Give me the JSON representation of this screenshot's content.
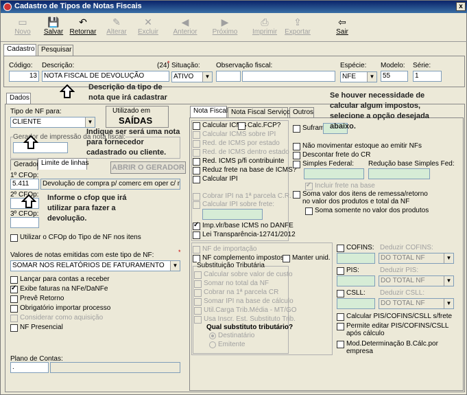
{
  "window": {
    "title": "Cadastro de Tipos de Notas Fiscais",
    "close": "x"
  },
  "toolbar": [
    {
      "label": "Novo",
      "icon": "new-icon",
      "enabled": false
    },
    {
      "label": "Salvar",
      "icon": "save-icon",
      "enabled": true
    },
    {
      "label": "Retornar",
      "icon": "undo-icon",
      "enabled": true
    },
    {
      "label": "Alterar",
      "icon": "edit-icon",
      "enabled": false
    },
    {
      "label": "Excluir",
      "icon": "delete-icon",
      "enabled": false
    },
    {
      "label": "Anterior",
      "icon": "arrow-left-icon",
      "enabled": false
    },
    {
      "label": "Próximo",
      "icon": "arrow-right-icon",
      "enabled": false
    },
    {
      "label": "Imprimir",
      "icon": "printer-icon",
      "enabled": false
    },
    {
      "label": "Exportar",
      "icon": "export-icon",
      "enabled": false
    },
    {
      "label": "Sair",
      "icon": "exit-icon",
      "enabled": true
    }
  ],
  "main_tabs": [
    "Cadastro",
    "Pesquisar"
  ],
  "header": {
    "codigo_label": "Código:",
    "codigo_value": "13",
    "descricao_label": "Descrição:",
    "descricao_counter": "(24)",
    "descricao_value": "NOTA FISCAL DE DEVOLUÇÃO",
    "situacao_label": "Situação:",
    "situacao_value": "ATIVO",
    "obs_label": "Observação fiscal:",
    "especie_label": "Espécie:",
    "especie_value": "NFE",
    "modelo_label": "Modelo:",
    "modelo_value": "55",
    "serie_label": "Série:",
    "serie_value": "1"
  },
  "left": {
    "tab_dados": "Dados",
    "tipo_nf_label": "Tipo de NF para:",
    "tipo_nf_value": "CLIENTE",
    "utilizado_em_label": "Utilizado em",
    "utilizado_em_value": "SAÍDAS",
    "gerador_group_label": "Gerador de impressão da nota fiscal:",
    "gerador_tab": "Gerador",
    "limite_tab": "Limite de linhas",
    "abrir_gerador": "ABRIR O GERADOR",
    "cfop1_label": "1º CFOp:",
    "cfop1_value": "5.411",
    "cfop1_desc": "Devolução de compra p/ comerc em oper c/ merc",
    "cfop2_label": "2º CFOp:",
    "cfop3_label": "3º CFOp:",
    "utilizar_cfop": "Utilizar o CFOp do Tipo de NF nos itens",
    "valores_label": "Valores de notas emitidas com este tipo de NF:",
    "valores_value": "SOMAR NOS RELATÓRIOS DE FATURAMENTO",
    "checks": [
      {
        "label": "Lançar para contas a receber",
        "checked": false,
        "enabled": true
      },
      {
        "label": "Exibe faturas na NFe/DaNFe",
        "checked": true,
        "enabled": true
      },
      {
        "label": "Prevê Retorno",
        "checked": false,
        "enabled": true
      },
      {
        "label": "Obrigatório importar processo",
        "checked": false,
        "enabled": true
      },
      {
        "label": "Considerar como aquisição",
        "checked": false,
        "enabled": false
      },
      {
        "label": "NF Presencial",
        "checked": false,
        "enabled": true
      }
    ],
    "plano_label": "Plano de Contas:",
    "plano_value": "."
  },
  "right_tabs": [
    "Nota Fiscal",
    "Nota Fiscal Serviço",
    "Outros"
  ],
  "icms_checks": [
    {
      "label": "Calcular ICMS",
      "checked": false,
      "enabled": true
    },
    {
      "label": "Calcular ICMS sobre IPI",
      "checked": false,
      "enabled": false
    },
    {
      "label": "Red. de ICMS por estado",
      "checked": false,
      "enabled": false
    },
    {
      "label": "Red. de ICMS dentro estado",
      "checked": false,
      "enabled": false
    },
    {
      "label": "Red. ICMS p/fi contribuinte",
      "checked": false,
      "enabled": true
    },
    {
      "label": "Reduz frete na base de ICMS?",
      "checked": false,
      "enabled": true
    },
    {
      "label": "Calcular IPI",
      "checked": false,
      "enabled": true
    }
  ],
  "calc_fcp": "Calc.FCP?",
  "ipi_checks": [
    {
      "label": "Cobrar IPI na 1ª parcela C.R.",
      "checked": false,
      "enabled": false
    },
    {
      "label": "Calcular IPI sobre frete:",
      "checked": false,
      "enabled": false
    }
  ],
  "imp_checks": [
    {
      "label": "Imp.vlr/base ICMS no DANFE",
      "checked": true,
      "enabled": true
    },
    {
      "label": "Lei Transparência-12741/2012",
      "checked": false,
      "enabled": true
    }
  ],
  "suframa": "Suframa",
  "estoque_checks": [
    {
      "label": "Não movimentar estoque ao emitir NFs",
      "checked": false
    },
    {
      "label": "Descontar frete do CR",
      "checked": false
    },
    {
      "label": "Simples Federal:",
      "checked": false
    }
  ],
  "reducao_label": "Redução base Simples Fed:",
  "incluir_frete": "Incluir frete na base",
  "soma_remessa": "Soma valor dos itens de remessa/retorno no valor dos produtos e total da NF",
  "soma_somente": "Soma somente no valor dos produtos",
  "lower_checks": [
    {
      "label": "NF de importação",
      "checked": false,
      "enabled": false
    },
    {
      "label": "NF complemento impostos",
      "checked": false,
      "enabled": true
    }
  ],
  "manter_unid": "Manter unid.",
  "st_group": "Substituição Tributária",
  "st_checks": [
    "Calcular sobre valor de custo",
    "Somar no total da NF",
    "Cobrar na 1ª parcela CR",
    "Somar IPI na base de cálculo",
    "Util.Carga Trib.Média - MT/GO",
    "Usa Inscr. Est. Substituto Trib."
  ],
  "qual_substituto": "Qual substituto tributário?",
  "radios": [
    {
      "label": "Destinatário",
      "checked": true
    },
    {
      "label": "Emitente",
      "checked": false
    }
  ],
  "taxes": [
    {
      "label": "COFINS:",
      "deduzir": "Deduzir COFINS:",
      "value": "DO TOTAL NF"
    },
    {
      "label": "PIS:",
      "deduzir": "Deduzir PIS:",
      "value": "DO TOTAL NF"
    },
    {
      "label": "CSLL:",
      "deduzir": "Deduzir CSLL:",
      "value": "DO TOTAL NF"
    }
  ],
  "tax_checks": [
    "Calcular PIS/COFINS/CSLL s/frete",
    "Permite editar PIS/COFINS/CSLL após cálculo",
    "Mod.Determinação B.Cálc.por empresa"
  ],
  "annotations": {
    "descricao_note": "Descrição da tipo de nota que irá cadastrar",
    "impostos_note": "Se houver necessidade de calcular algum impostos, selecione a opção desejada abaixo.",
    "tipo_note": "Indique ser será uma nota para fornecedor cadastrado ou cliente.",
    "cfop_note": "Informe o cfop que irá utilizar para fazer a devolução."
  },
  "colors": {
    "title_start": "#0a246a",
    "title_end": "#3a6ea5",
    "window_bg": "#ece9d8",
    "field_green": "#d6ecd6"
  }
}
